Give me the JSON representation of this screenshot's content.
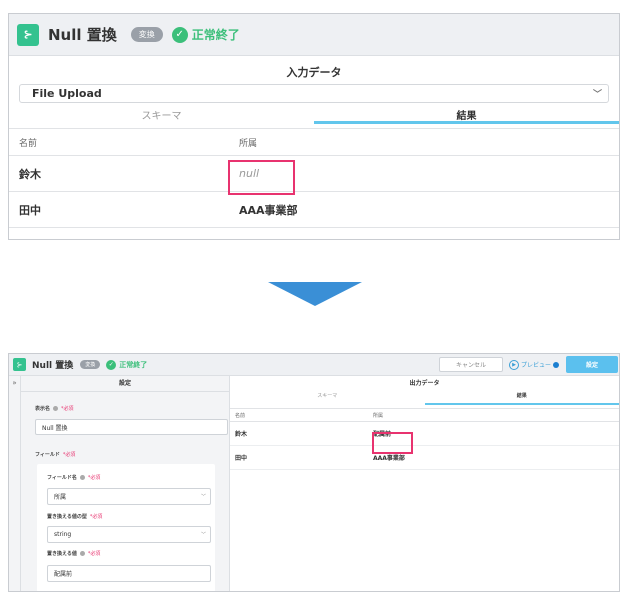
{
  "before": {
    "title": "Null 置換",
    "badge": "変換",
    "status": "正常終了",
    "input_label": "入力データ",
    "source": "File Upload",
    "tabs": [
      "スキーマ",
      "結果"
    ],
    "columns": [
      "名前",
      "所属"
    ],
    "rows": [
      {
        "name": "鈴木",
        "dept": "null"
      },
      {
        "name": "田中",
        "dept": "AAA事業部"
      }
    ]
  },
  "after": {
    "title": "Null 置換",
    "badge": "変換",
    "status": "正常終了",
    "cancel_label": "キャンセル",
    "preview_label": "プレビュー",
    "settings_btn": "設定",
    "collapse": "»",
    "settings_head": "設定",
    "display_name_label": "表示名",
    "required": "*必須",
    "display_name_value": "Null 置換",
    "fields_label": "フィールド",
    "field_name_label": "フィールド名",
    "field_name_value": "所属",
    "replace_type_label": "置き換える値の型",
    "replace_type_value": "string",
    "replace_value_label": "置き換える値",
    "replace_value": "配属前",
    "output_label": "出力データ",
    "tabs": [
      "スキーマ",
      "結果"
    ],
    "columns": [
      "名前",
      "所属"
    ],
    "rows": [
      {
        "name": "鈴木",
        "dept": "配属前"
      },
      {
        "name": "田中",
        "dept": "AAA事業部"
      }
    ]
  },
  "colors": {
    "accent_green": "#34c28f",
    "accent_blue": "#5bc0ee",
    "highlight": "#e8336f",
    "arrow": "#3a8fd6"
  }
}
